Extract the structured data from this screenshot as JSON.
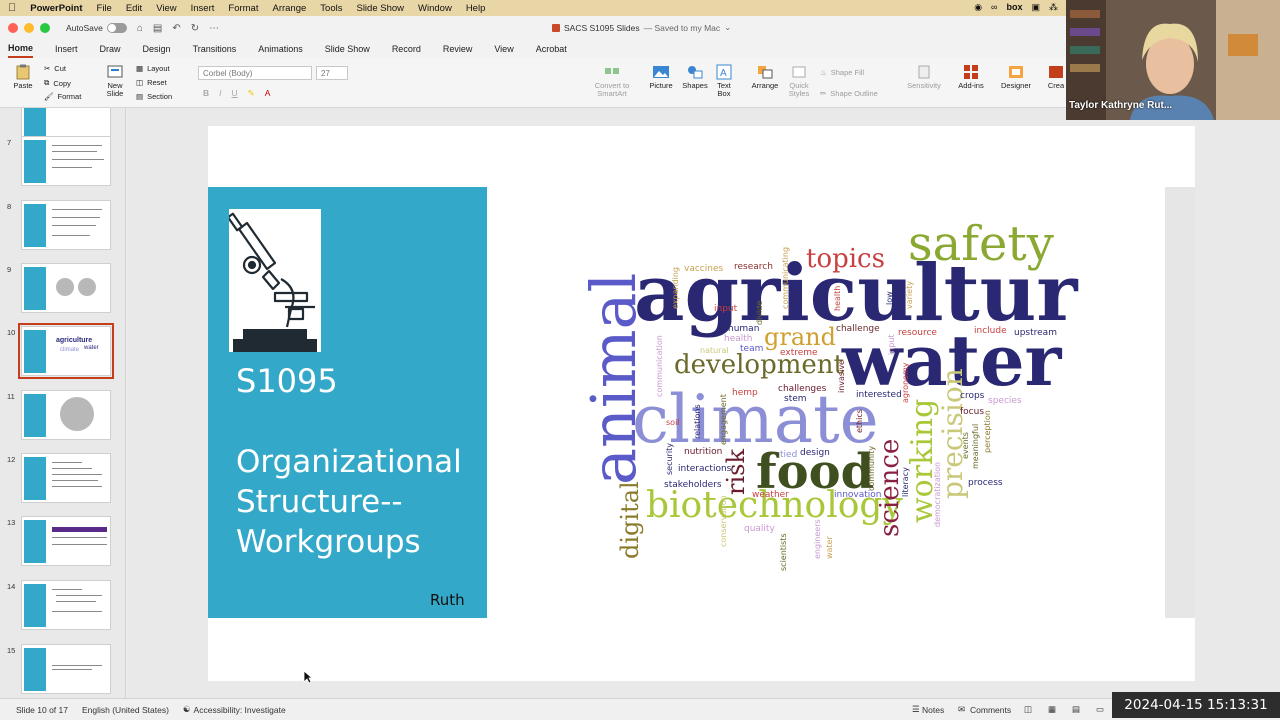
{
  "menubar": {
    "app": "PowerPoint",
    "items": [
      "File",
      "Edit",
      "View",
      "Insert",
      "Format",
      "Arrange",
      "Tools",
      "Slide Show",
      "Window",
      "Help"
    ]
  },
  "titlebar": {
    "autosave_label": "AutoSave",
    "doc_title": "SACS S1095 Slides",
    "save_status": "— Saved to my Mac"
  },
  "tabs": [
    "Home",
    "Insert",
    "Draw",
    "Design",
    "Transitions",
    "Animations",
    "Slide Show",
    "Record",
    "Review",
    "View",
    "Acrobat"
  ],
  "ribbon": {
    "paste": "Paste",
    "cut": "Cut",
    "copy": "Copy",
    "format": "Format",
    "new_slide": "New Slide",
    "layout": "Layout",
    "reset": "Reset",
    "section": "Section",
    "font_name": "Corbel (Body)",
    "font_size": "27",
    "convert": "Convert to SmartArt",
    "picture": "Picture",
    "shapes": "Shapes",
    "text_box": "Text Box",
    "arrange": "Arrange",
    "quick_styles": "Quick Styles",
    "shape_fill": "Shape Fill",
    "shape_outline": "Shape Outline",
    "sensitivity": "Sensitivity",
    "addins": "Add-ins",
    "designer": "Designer",
    "create": "Crea"
  },
  "thumbnails": [
    {
      "num": "7"
    },
    {
      "num": "8"
    },
    {
      "num": "9"
    },
    {
      "num": "10"
    },
    {
      "num": "11"
    },
    {
      "num": "12"
    },
    {
      "num": "13"
    },
    {
      "num": "14"
    },
    {
      "num": "15"
    }
  ],
  "slide": {
    "code": "S1095",
    "title": "Organizational Structure--Workgroups",
    "author": "Ruth",
    "word_cloud": [
      "agriculture",
      "climate",
      "water",
      "animal",
      "safety",
      "food",
      "biotechnology",
      "development",
      "topics",
      "grand",
      "science",
      "working",
      "precision",
      "digital",
      "risk",
      "research",
      "vaccines",
      "challenge",
      "resource",
      "include",
      "upstream",
      "human",
      "extreme",
      "team",
      "challenges",
      "stem",
      "interested",
      "hemp",
      "crops",
      "focus",
      "species",
      "events",
      "meaningful",
      "perception",
      "workforce",
      "process",
      "innovation",
      "weather",
      "quality",
      "conservation",
      "scientists",
      "engineers",
      "stakeholders",
      "interactions",
      "nutrition",
      "relations",
      "engagement",
      "soil",
      "security",
      "ethics",
      "design",
      "tied",
      "community",
      "literacy",
      "democratization",
      "invasive",
      "agronomy",
      "input",
      "health",
      "low",
      "variety",
      "solar",
      "mesa",
      "communication",
      "communicating",
      "expanding",
      "divide",
      "natural"
    ]
  },
  "status": {
    "slide_info": "Slide 10 of 17",
    "language": "English (United States)",
    "accessibility": "Accessibility: Investigate",
    "notes": "Notes",
    "comments": "Comments"
  },
  "webcam_name": "Taylor Kathryne Rut...",
  "timestamp": "2024-04-15  15:13:31"
}
